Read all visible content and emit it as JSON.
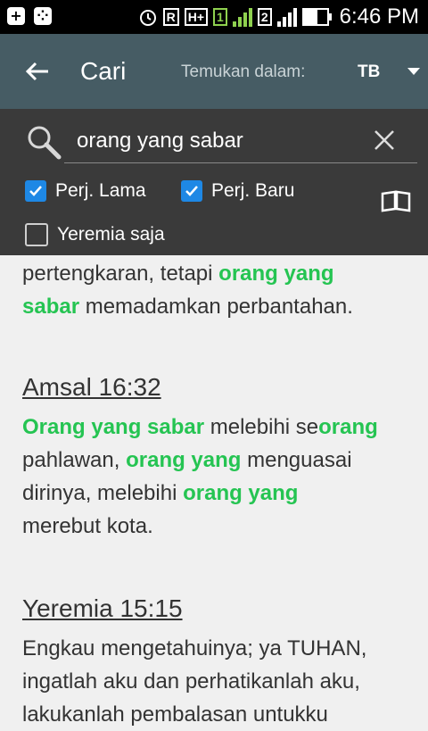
{
  "status_bar": {
    "time": "6:46 PM",
    "network_badge": "R",
    "network_type": "H+",
    "sim1": "1",
    "sim2": "2"
  },
  "app_bar": {
    "title": "Cari",
    "find_in_label": "Temukan dalam:",
    "version": "TB"
  },
  "search": {
    "query": "orang yang sabar"
  },
  "filters": {
    "old_testament": {
      "label": "Perj. Lama",
      "checked": true
    },
    "new_testament": {
      "label": "Perj. Baru",
      "checked": true
    },
    "jeremiah_only": {
      "label": "Yeremia saja",
      "checked": false
    }
  },
  "results": {
    "r1": {
      "line1_a": "pertengkaran, tetapi ",
      "line1_b": "orang yang",
      "line2_a": "sabar",
      "line2_b": " memadamkan perbantahan."
    },
    "r2": {
      "reference": "Amsal 16:32",
      "l1_a": "Orang yang sabar",
      "l1_b": " melebihi se",
      "l1_c": "orang",
      "l2_a": "pahlawan, ",
      "l2_b": "orang yang",
      "l2_c": " menguasai",
      "l3_a": "dirinya, melebihi ",
      "l3_b": "orang yang",
      "l4": "merebut kota."
    },
    "r3": {
      "reference": "Yeremia 15:15",
      "l1": "Engkau mengetahuinya; ya TUHAN,",
      "l2": "ingatlah aku dan perhatikanlah aku,",
      "l3": "lakukanlah pembalasan untukku"
    }
  },
  "colors": {
    "highlight": "#25c452",
    "app_bar": "#465c64",
    "search_panel": "#3a3a3a",
    "checkbox": "#1e88e5"
  }
}
